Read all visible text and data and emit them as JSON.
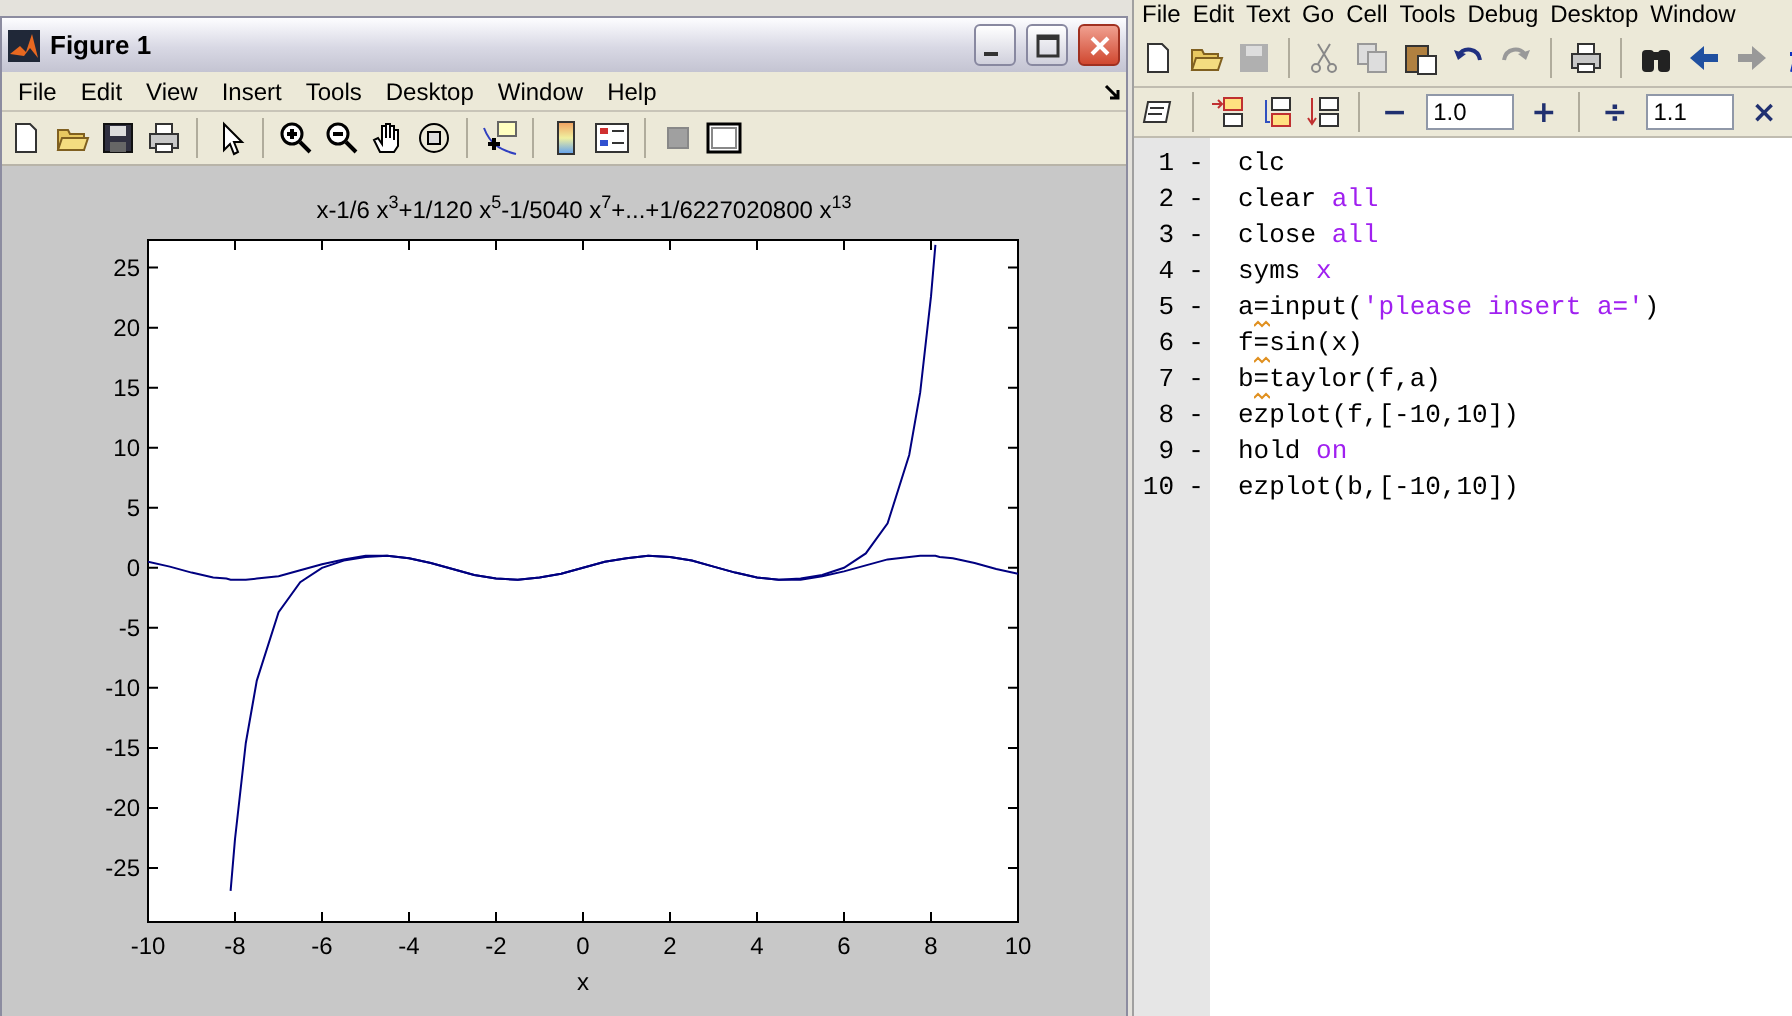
{
  "figure_window": {
    "title": "Figure 1",
    "menu": [
      "File",
      "Edit",
      "View",
      "Insert",
      "Tools",
      "Desktop",
      "Window",
      "Help"
    ],
    "plot": {
      "chart_data": {
        "type": "line",
        "title": "x-1/6 x$^{3}$+1/120 x$^{5}$-1/5040 x$^{7}$+...+1/6227020800 x$^{13}$",
        "xlabel": "x",
        "x": [
          -10,
          -9.5,
          -9,
          -8.5,
          -8.2,
          -8.1,
          -8,
          -7.75,
          -7.5,
          -7,
          -6.5,
          -6,
          -5.5,
          -5,
          -4.5,
          -4,
          -3.5,
          -3,
          -2.5,
          -2,
          -1.5,
          -1,
          -0.5,
          0,
          0.5,
          1,
          1.5,
          2,
          2.5,
          3,
          3.5,
          4,
          4.5,
          5,
          5.5,
          6,
          6.5,
          7,
          7.5,
          7.75,
          8,
          8.1,
          8.2,
          8.5,
          9,
          9.5,
          10
        ],
        "series": [
          {
            "color": "#000080",
            "values": [
              0.5,
              0.1,
              -0.4,
              -0.8,
              -0.9,
              -1,
              -1,
              -1,
              -0.9,
              -0.7,
              -0.2,
              0.3,
              0.7,
              1,
              1,
              0.8,
              0.4,
              -0.1,
              -0.6,
              -0.9,
              -1,
              -0.8,
              -0.5,
              0,
              0.5,
              0.8,
              1,
              0.9,
              0.6,
              0.1,
              -0.4,
              -0.8,
              -1,
              -1,
              -0.7,
              -0.3,
              0.2,
              0.7,
              0.9,
              1,
              1,
              1,
              0.9,
              0.8,
              0.4,
              -0.1,
              -0.5
            ]
          },
          {
            "color": "#000080",
            "values": [
              null,
              null,
              null,
              null,
              null,
              -26.9,
              -22.6,
              -14.6,
              -9.4,
              -3.7,
              -1.2,
              0,
              0.6,
              0.9,
              1,
              0.8,
              0.4,
              -0.1,
              -0.6,
              -0.9,
              -1,
              -0.8,
              -0.5,
              0,
              0.5,
              0.8,
              1,
              0.9,
              0.6,
              0.1,
              -0.4,
              -0.8,
              -1,
              -0.9,
              -0.6,
              0,
              1.2,
              3.7,
              9.4,
              14.6,
              22.6,
              26.9,
              null,
              null,
              null,
              null,
              null
            ]
          }
        ],
        "xlim": [
          -10,
          10
        ],
        "ylim": [
          -29.5,
          27.3
        ],
        "xticks": [
          -10,
          -8,
          -6,
          -4,
          -2,
          0,
          2,
          4,
          6,
          8,
          10
        ],
        "yticks": [
          -25,
          -20,
          -15,
          -10,
          -5,
          0,
          5,
          10,
          15,
          20,
          25
        ]
      }
    }
  },
  "editor": {
    "menu": [
      "File",
      "Edit",
      "Text",
      "Go",
      "Cell",
      "Tools",
      "Debug",
      "Desktop",
      "Window"
    ],
    "cell_toolbar": {
      "decrement": "−",
      "value_1": "1.0",
      "increment": "+",
      "divide": "÷",
      "value_2": "1.1",
      "multiply": "×"
    },
    "lines": [
      {
        "number": "1",
        "marker": "-",
        "warning": false,
        "tokens": [
          {
            "text": "clc",
            "kind": "code"
          }
        ]
      },
      {
        "number": "2",
        "marker": "-",
        "warning": false,
        "tokens": [
          {
            "text": "clear ",
            "kind": "code"
          },
          {
            "text": "all",
            "kind": "string"
          }
        ]
      },
      {
        "number": "3",
        "marker": "-",
        "warning": false,
        "tokens": [
          {
            "text": "close ",
            "kind": "code"
          },
          {
            "text": "all",
            "kind": "string"
          }
        ]
      },
      {
        "number": "4",
        "marker": "-",
        "warning": false,
        "tokens": [
          {
            "text": "syms ",
            "kind": "code"
          },
          {
            "text": "x",
            "kind": "string"
          }
        ]
      },
      {
        "number": "5",
        "marker": "-",
        "warning": true,
        "tokens": [
          {
            "text": "a=input(",
            "kind": "code"
          },
          {
            "text": "'please insert a='",
            "kind": "string"
          },
          {
            "text": ")",
            "kind": "code"
          }
        ]
      },
      {
        "number": "6",
        "marker": "-",
        "warning": true,
        "tokens": [
          {
            "text": "f=sin(x)",
            "kind": "code"
          }
        ]
      },
      {
        "number": "7",
        "marker": "-",
        "warning": true,
        "tokens": [
          {
            "text": "b=taylor(f,a)",
            "kind": "code"
          }
        ]
      },
      {
        "number": "8",
        "marker": "-",
        "warning": false,
        "tokens": [
          {
            "text": "ezplot(f,[-10,10])",
            "kind": "code"
          }
        ]
      },
      {
        "number": "9",
        "marker": "-",
        "warning": false,
        "tokens": [
          {
            "text": "hold ",
            "kind": "code"
          },
          {
            "text": "on",
            "kind": "string"
          }
        ]
      },
      {
        "number": "10",
        "marker": "-",
        "warning": false,
        "tokens": [
          {
            "text": "ezplot(b,[-10,10])",
            "kind": "code"
          }
        ]
      }
    ]
  }
}
